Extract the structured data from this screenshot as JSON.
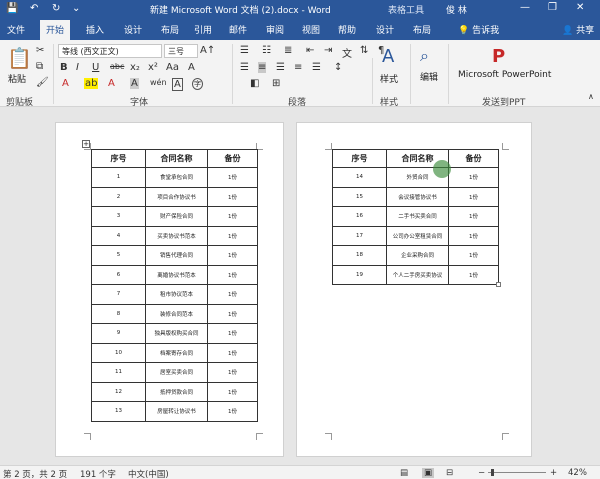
{
  "titlebar": {
    "title": "新建 Microsoft Word 文档 (2).docx  -  Word",
    "context_tab": "表格工具",
    "user": "俊 林",
    "save_glyph": "💾",
    "undo_glyph": "↶",
    "redo_glyph": "↻",
    "customize_glyph": "⌄",
    "minimize_glyph": "—",
    "restore_glyph": "❐",
    "close_glyph": "✕"
  },
  "tabs": [
    "文件",
    "开始",
    "插入",
    "设计",
    "布局",
    "引用",
    "邮件",
    "审阅",
    "视图",
    "帮助",
    "设计",
    "布局",
    "告诉我"
  ],
  "active_tab": 1,
  "share": "共享",
  "ribbon": {
    "clipboard": {
      "paste": "粘贴",
      "label": "剪贴板"
    },
    "font": {
      "name": "等线 (西文正文)",
      "size": "三号",
      "label": "字体",
      "bold": "B",
      "italic": "I",
      "underline": "U",
      "strike": "abc",
      "subscript": "x₂",
      "superscript": "x²",
      "grow": "A↑",
      "shrink": "A↓",
      "case": "Aa",
      "clear": "A",
      "highlight": "ab",
      "color": "A",
      "char_border": "A",
      "wen": "wén",
      "phonetic": "A",
      "enclose": "字"
    },
    "paragraph": {
      "label": "段落"
    },
    "styles": {
      "label": "样式"
    },
    "editing": {
      "label": "编辑"
    },
    "powerpoint": {
      "label": "Microsoft PowerPoint",
      "group": "发送到PPT"
    }
  },
  "table_headers": [
    "序号",
    "合同名称",
    "备份"
  ],
  "page1_rows": [
    [
      "1",
      "食堂承包合同",
      "1份"
    ],
    [
      "2",
      "项目合作协议书",
      "1份"
    ],
    [
      "3",
      "财产保险合同",
      "1份"
    ],
    [
      "4",
      "买卖协议书范本",
      "1份"
    ],
    [
      "5",
      "销售代理合同",
      "1份"
    ],
    [
      "6",
      "离婚协议书范本",
      "1份"
    ],
    [
      "7",
      "租市协议范本",
      "1份"
    ],
    [
      "8",
      "装修合同范本",
      "1份"
    ],
    [
      "9",
      "独具版权购买合同",
      "1份"
    ],
    [
      "10",
      "档案寄存合同",
      "1份"
    ],
    [
      "11",
      "居室买卖合同",
      "1份"
    ],
    [
      "12",
      "抵押贷款合同",
      "1份"
    ],
    [
      "13",
      "房屋转让协议书",
      "1份"
    ]
  ],
  "page2_rows": [
    [
      "14",
      "外贸合同",
      "1份"
    ],
    [
      "15",
      "会议接管协议书",
      "1份"
    ],
    [
      "16",
      "二手书买卖合同",
      "1份"
    ],
    [
      "17",
      "公司办公室租赁合同",
      "1份"
    ],
    [
      "18",
      "企业采购合同",
      "1份"
    ],
    [
      "19",
      "个人二手房买卖协议",
      "1份"
    ]
  ],
  "status": {
    "page": "第 2 页，共 2 页",
    "words": "191 个字",
    "lang": "中文(中国)",
    "zoom": "42%",
    "minus": "−",
    "plus": "+"
  },
  "colors": {
    "brand": "#2b579a",
    "ribbon_bg": "#f3f3f3",
    "canvas": "#e6e6e6"
  }
}
